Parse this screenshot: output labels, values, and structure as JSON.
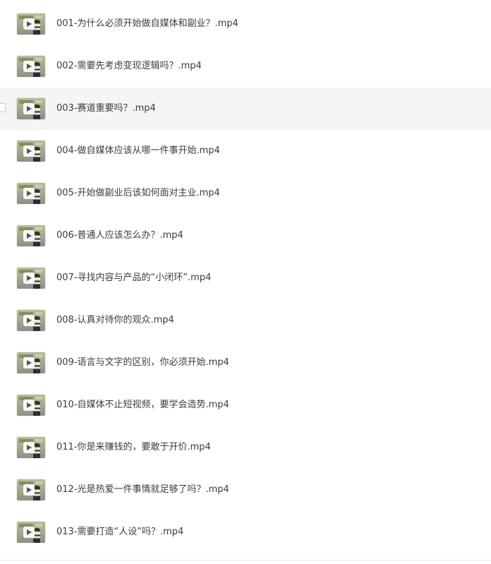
{
  "files": [
    {
      "name": "001-为什么必须开始做自媒体和副业？.mp4",
      "icon": "video-thumbnail-icon"
    },
    {
      "name": "002-需要先考虑变现逻辑吗？.mp4",
      "icon": "video-thumbnail-icon"
    },
    {
      "name": "003-赛道重要吗？.mp4",
      "icon": "video-thumbnail-icon",
      "hovered": true
    },
    {
      "name": "004-做自媒体应该从哪一件事开始.mp4",
      "icon": "video-thumbnail-icon"
    },
    {
      "name": "005-开始做副业后该如何面对主业.mp4",
      "icon": "video-thumbnail-icon"
    },
    {
      "name": "006-普通人应该怎么办？.mp4",
      "icon": "video-thumbnail-icon"
    },
    {
      "name": "007-寻找内容与产品的“小闭环”.mp4",
      "icon": "video-thumbnail-icon"
    },
    {
      "name": "008-认真对待你的观众.mp4",
      "icon": "video-thumbnail-icon"
    },
    {
      "name": "009-语言与文字的区别，你必须开始.mp4",
      "icon": "video-thumbnail-icon"
    },
    {
      "name": "010-自媒体不止短视频，要学会造势.mp4",
      "icon": "video-thumbnail-icon"
    },
    {
      "name": "011-你是来赚钱的，要敢于开价.mp4",
      "icon": "video-thumbnail-icon"
    },
    {
      "name": "012-光是热爱一件事情就足够了吗？.mp4",
      "icon": "video-thumbnail-icon"
    },
    {
      "name": "013-需要打造“人设”吗？.mp4",
      "icon": "video-thumbnail-icon"
    }
  ],
  "colors": {
    "text": "#3c3c3c",
    "hover_background": "#f5f5f6",
    "divider": "#ececee"
  }
}
